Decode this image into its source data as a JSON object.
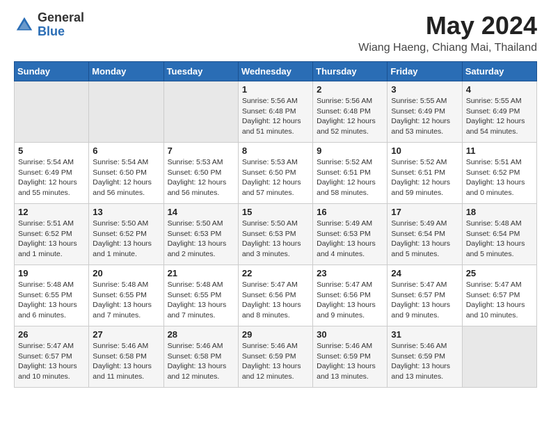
{
  "header": {
    "logo_general": "General",
    "logo_blue": "Blue",
    "title": "May 2024",
    "subtitle": "Wiang Haeng, Chiang Mai, Thailand"
  },
  "days_of_week": [
    "Sunday",
    "Monday",
    "Tuesday",
    "Wednesday",
    "Thursday",
    "Friday",
    "Saturday"
  ],
  "weeks": [
    [
      {
        "day": "",
        "info": ""
      },
      {
        "day": "",
        "info": ""
      },
      {
        "day": "",
        "info": ""
      },
      {
        "day": "1",
        "info": "Sunrise: 5:56 AM\nSunset: 6:48 PM\nDaylight: 12 hours\nand 51 minutes."
      },
      {
        "day": "2",
        "info": "Sunrise: 5:56 AM\nSunset: 6:48 PM\nDaylight: 12 hours\nand 52 minutes."
      },
      {
        "day": "3",
        "info": "Sunrise: 5:55 AM\nSunset: 6:49 PM\nDaylight: 12 hours\nand 53 minutes."
      },
      {
        "day": "4",
        "info": "Sunrise: 5:55 AM\nSunset: 6:49 PM\nDaylight: 12 hours\nand 54 minutes."
      }
    ],
    [
      {
        "day": "5",
        "info": "Sunrise: 5:54 AM\nSunset: 6:49 PM\nDaylight: 12 hours\nand 55 minutes."
      },
      {
        "day": "6",
        "info": "Sunrise: 5:54 AM\nSunset: 6:50 PM\nDaylight: 12 hours\nand 56 minutes."
      },
      {
        "day": "7",
        "info": "Sunrise: 5:53 AM\nSunset: 6:50 PM\nDaylight: 12 hours\nand 56 minutes."
      },
      {
        "day": "8",
        "info": "Sunrise: 5:53 AM\nSunset: 6:50 PM\nDaylight: 12 hours\nand 57 minutes."
      },
      {
        "day": "9",
        "info": "Sunrise: 5:52 AM\nSunset: 6:51 PM\nDaylight: 12 hours\nand 58 minutes."
      },
      {
        "day": "10",
        "info": "Sunrise: 5:52 AM\nSunset: 6:51 PM\nDaylight: 12 hours\nand 59 minutes."
      },
      {
        "day": "11",
        "info": "Sunrise: 5:51 AM\nSunset: 6:52 PM\nDaylight: 13 hours\nand 0 minutes."
      }
    ],
    [
      {
        "day": "12",
        "info": "Sunrise: 5:51 AM\nSunset: 6:52 PM\nDaylight: 13 hours\nand 1 minute."
      },
      {
        "day": "13",
        "info": "Sunrise: 5:50 AM\nSunset: 6:52 PM\nDaylight: 13 hours\nand 1 minute."
      },
      {
        "day": "14",
        "info": "Sunrise: 5:50 AM\nSunset: 6:53 PM\nDaylight: 13 hours\nand 2 minutes."
      },
      {
        "day": "15",
        "info": "Sunrise: 5:50 AM\nSunset: 6:53 PM\nDaylight: 13 hours\nand 3 minutes."
      },
      {
        "day": "16",
        "info": "Sunrise: 5:49 AM\nSunset: 6:53 PM\nDaylight: 13 hours\nand 4 minutes."
      },
      {
        "day": "17",
        "info": "Sunrise: 5:49 AM\nSunset: 6:54 PM\nDaylight: 13 hours\nand 5 minutes."
      },
      {
        "day": "18",
        "info": "Sunrise: 5:48 AM\nSunset: 6:54 PM\nDaylight: 13 hours\nand 5 minutes."
      }
    ],
    [
      {
        "day": "19",
        "info": "Sunrise: 5:48 AM\nSunset: 6:55 PM\nDaylight: 13 hours\nand 6 minutes."
      },
      {
        "day": "20",
        "info": "Sunrise: 5:48 AM\nSunset: 6:55 PM\nDaylight: 13 hours\nand 7 minutes."
      },
      {
        "day": "21",
        "info": "Sunrise: 5:48 AM\nSunset: 6:55 PM\nDaylight: 13 hours\nand 7 minutes."
      },
      {
        "day": "22",
        "info": "Sunrise: 5:47 AM\nSunset: 6:56 PM\nDaylight: 13 hours\nand 8 minutes."
      },
      {
        "day": "23",
        "info": "Sunrise: 5:47 AM\nSunset: 6:56 PM\nDaylight: 13 hours\nand 9 minutes."
      },
      {
        "day": "24",
        "info": "Sunrise: 5:47 AM\nSunset: 6:57 PM\nDaylight: 13 hours\nand 9 minutes."
      },
      {
        "day": "25",
        "info": "Sunrise: 5:47 AM\nSunset: 6:57 PM\nDaylight: 13 hours\nand 10 minutes."
      }
    ],
    [
      {
        "day": "26",
        "info": "Sunrise: 5:47 AM\nSunset: 6:57 PM\nDaylight: 13 hours\nand 10 minutes."
      },
      {
        "day": "27",
        "info": "Sunrise: 5:46 AM\nSunset: 6:58 PM\nDaylight: 13 hours\nand 11 minutes."
      },
      {
        "day": "28",
        "info": "Sunrise: 5:46 AM\nSunset: 6:58 PM\nDaylight: 13 hours\nand 12 minutes."
      },
      {
        "day": "29",
        "info": "Sunrise: 5:46 AM\nSunset: 6:59 PM\nDaylight: 13 hours\nand 12 minutes."
      },
      {
        "day": "30",
        "info": "Sunrise: 5:46 AM\nSunset: 6:59 PM\nDaylight: 13 hours\nand 13 minutes."
      },
      {
        "day": "31",
        "info": "Sunrise: 5:46 AM\nSunset: 6:59 PM\nDaylight: 13 hours\nand 13 minutes."
      },
      {
        "day": "",
        "info": ""
      }
    ]
  ]
}
